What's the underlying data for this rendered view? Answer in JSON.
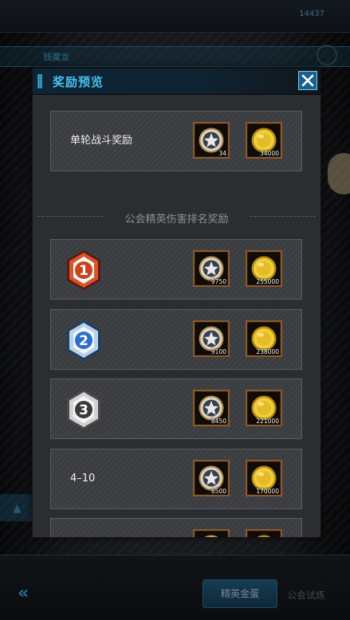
{
  "background": {
    "currency_value": "14437",
    "tab_label": "钱魔龙",
    "bottom_button_label": "精英金蛋",
    "bottom_secondary_label": "公会试炼"
  },
  "modal": {
    "title": "奖励预览",
    "single_battle": {
      "label": "单轮战斗奖励",
      "rewards": [
        {
          "item": "silver-medal",
          "qty": "34"
        },
        {
          "item": "gold-coin",
          "qty": "34000"
        }
      ]
    },
    "section_title": "公会精英伤害排名奖励",
    "ranks": [
      {
        "rank": "1",
        "badge_color": "#c8441f",
        "rewards": [
          {
            "item": "silver-medal",
            "qty": "9750"
          },
          {
            "item": "gold-coin",
            "qty": "255000"
          }
        ]
      },
      {
        "rank": "2",
        "badge_color": "#2a6fd0",
        "rewards": [
          {
            "item": "silver-medal",
            "qty": "9100"
          },
          {
            "item": "gold-coin",
            "qty": "238000"
          }
        ]
      },
      {
        "rank": "3",
        "badge_color": "#8d8d8d",
        "rewards": [
          {
            "item": "silver-medal",
            "qty": "8450"
          },
          {
            "item": "gold-coin",
            "qty": "221000"
          }
        ]
      },
      {
        "label": "4–10",
        "rewards": [
          {
            "item": "silver-medal",
            "qty": "6500"
          },
          {
            "item": "gold-coin",
            "qty": "170000"
          }
        ]
      }
    ]
  },
  "colors": {
    "accent": "#48c0f0",
    "slot_border": "#8a5a2c",
    "gold": "#e8c33a"
  }
}
